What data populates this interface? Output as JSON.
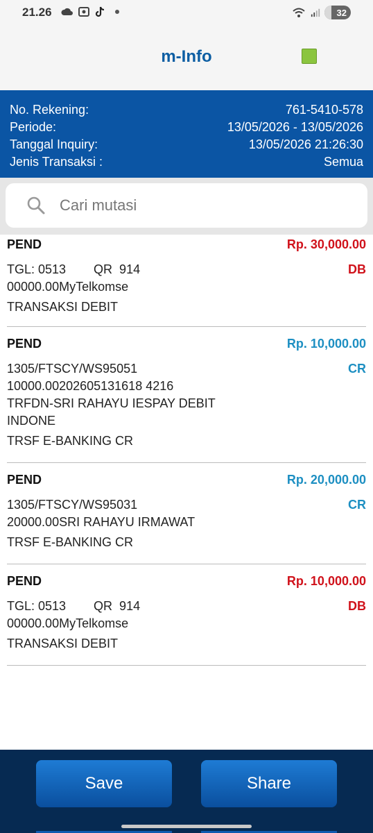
{
  "status_bar": {
    "time": "21.26",
    "battery": "32"
  },
  "app": {
    "title": "m-Info",
    "indicator_color": "#8bc53f"
  },
  "info": [
    {
      "label": "No. Rekening:",
      "value": "761-5410-578"
    },
    {
      "label": "Periode:",
      "value": "13/05/2026 - 13/05/2026"
    },
    {
      "label": "Tanggal Inquiry:",
      "value": "13/05/2026 21:26:30"
    },
    {
      "label": "Jenis Transaksi :",
      "value": "Semua"
    }
  ],
  "search": {
    "placeholder": "Cari mutasi"
  },
  "transactions": [
    {
      "status": "PEND",
      "amount": "Rp. 30,000.00",
      "type": "DB",
      "desc": [
        "TGL: 0513        QR  914",
        "00000.00MyTelkomse"
      ],
      "category": "TRANSAKSI DEBIT"
    },
    {
      "status": "PEND",
      "amount": "Rp. 10,000.00",
      "type": "CR",
      "desc": [
        "1305/FTSCY/WS95051",
        "10000.00202605131618 4216",
        "TRFDN-SRI RAHAYU IESPAY DEBIT",
        "INDONE"
      ],
      "category": "TRSF E-BANKING CR"
    },
    {
      "status": "PEND",
      "amount": "Rp. 20,000.00",
      "type": "CR",
      "desc": [
        "1305/FTSCY/WS95031",
        "20000.00SRI RAHAYU IRMAWAT"
      ],
      "category": "TRSF E-BANKING CR"
    },
    {
      "status": "PEND",
      "amount": "Rp. 10,000.00",
      "type": "DB",
      "desc": [
        "TGL: 0513        QR  914",
        "00000.00MyTelkomse"
      ],
      "category": "TRANSAKSI DEBIT"
    }
  ],
  "actions": {
    "save_label": "Save",
    "share_label": "Share"
  },
  "colors": {
    "primary": "#0b55a4",
    "debit": "#d0121b",
    "credit": "#1d8fc2",
    "bottom_bar": "#062a52"
  }
}
